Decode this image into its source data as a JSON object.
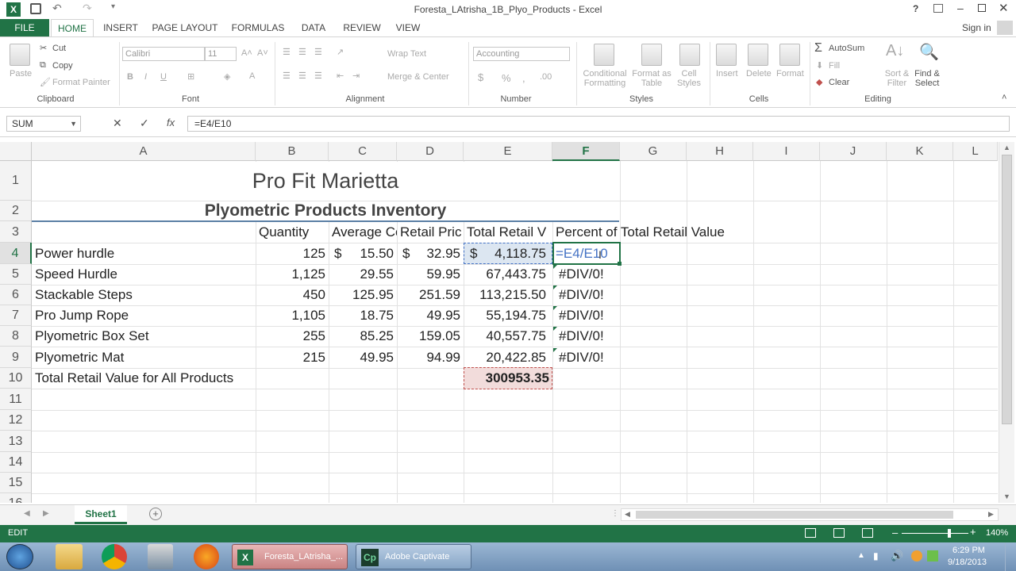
{
  "titlebar": {
    "title": "Foresta_LAtrisha_1B_Plyo_Products - Excel",
    "help": "?",
    "signin": "Sign in"
  },
  "tabs": [
    "FILE",
    "HOME",
    "INSERT",
    "PAGE LAYOUT",
    "FORMULAS",
    "DATA",
    "REVIEW",
    "VIEW"
  ],
  "ribbon": {
    "clipboard": {
      "paste": "Paste",
      "cut": "Cut",
      "copy": "Copy",
      "format_painter": "Format Painter",
      "label": "Clipboard"
    },
    "font": {
      "name": "Calibri",
      "size": "11",
      "bold": "B",
      "italic": "I",
      "underline": "U",
      "label": "Font"
    },
    "alignment": {
      "wrap": "Wrap Text",
      "merge": "Merge & Center",
      "label": "Alignment"
    },
    "number": {
      "format": "Accounting",
      "currency": "$",
      "percent": "%",
      "comma": ",",
      "label": "Number"
    },
    "styles": {
      "conditional": "Conditional Formatting",
      "format_table": "Format as Table",
      "cell_styles": "Cell Styles",
      "label": "Styles"
    },
    "cells": {
      "insert": "Insert",
      "delete": "Delete",
      "format": "Format",
      "label": "Cells"
    },
    "editing": {
      "autosum": "AutoSum",
      "fill": "Fill",
      "clear": "Clear",
      "sort": "Sort & Filter",
      "find": "Find & Select",
      "label": "Editing"
    }
  },
  "formula_bar": {
    "name_box": "SUM",
    "fx": "fx",
    "formula": "=E4/E10"
  },
  "columns": [
    "A",
    "B",
    "C",
    "D",
    "E",
    "F",
    "G",
    "H",
    "I",
    "J",
    "K",
    "L"
  ],
  "rows": [
    "1",
    "2",
    "3",
    "4",
    "5",
    "6",
    "7",
    "8",
    "9",
    "10",
    "11",
    "12",
    "13",
    "14",
    "15",
    "16"
  ],
  "sheet": {
    "title": "Pro Fit Marietta",
    "subtitle": "Plyometric Products Inventory",
    "headers": [
      "Quantity",
      "Average Co",
      "Retail Pric",
      "Total Retail V",
      "Percent of Total Retail Value"
    ],
    "items": [
      {
        "name": "Power hurdle",
        "qty": "125",
        "avg_cur": "$",
        "avg": "15.50",
        "ret_cur": "$",
        "ret": "32.95",
        "tot_cur": "$",
        "tot": "4,118.75",
        "pct": "=E4/E10"
      },
      {
        "name": "Speed Hurdle",
        "qty": "1,125",
        "avg": "29.55",
        "ret": "59.95",
        "tot": "67,443.75",
        "pct": "#DIV/0!"
      },
      {
        "name": "Stackable Steps",
        "qty": "450",
        "avg": "125.95",
        "ret": "251.59",
        "tot": "113,215.50",
        "pct": "#DIV/0!"
      },
      {
        "name": "Pro Jump Rope",
        "qty": "1,105",
        "avg": "18.75",
        "ret": "49.95",
        "tot": "55,194.75",
        "pct": "#DIV/0!"
      },
      {
        "name": "Plyometric Box Set",
        "qty": "255",
        "avg": "85.25",
        "ret": "159.05",
        "tot": "40,557.75",
        "pct": "#DIV/0!"
      },
      {
        "name": "Plyometric Mat",
        "qty": "215",
        "avg": "49.95",
        "ret": "94.99",
        "tot": "20,422.85",
        "pct": "#DIV/0!"
      }
    ],
    "total_label": "Total Retail Value for All Products",
    "total_value": "300953.35"
  },
  "sheet_tab": "Sheet1",
  "status": {
    "mode": "EDIT",
    "zoom": "140%"
  },
  "taskbar": {
    "excel_label": "Foresta_LAtrisha_...",
    "captivate_label": "Adobe Captivate",
    "time": "6:29 PM",
    "date": "9/18/2013"
  },
  "colors": {
    "excel_green": "#217346",
    "selection_blue": "#4472c4",
    "ref_red": "#c0504d"
  }
}
